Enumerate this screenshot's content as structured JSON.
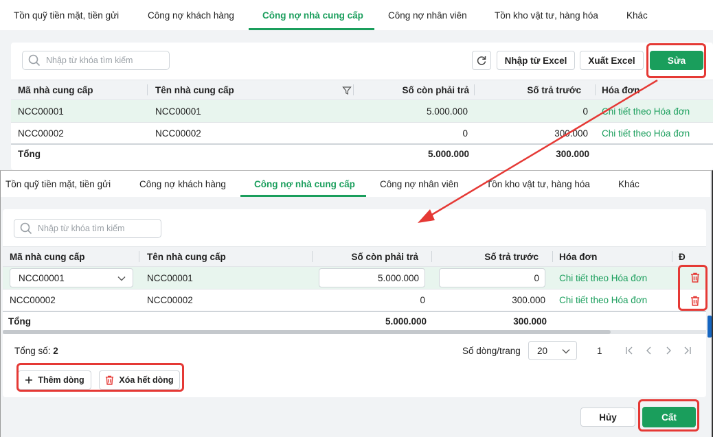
{
  "tabs": [
    "Tồn quỹ tiền mặt, tiền gửi",
    "Công nợ khách hàng",
    "Công nợ nhà cung cấp",
    "Công nợ nhân viên",
    "Tồn kho vật tư, hàng hóa",
    "Khác"
  ],
  "search_placeholder": "Nhập từ khóa tìm kiếm",
  "toolbar": {
    "import_label": "Nhập từ Excel",
    "export_label": "Xuất Excel",
    "edit_label": "Sửa"
  },
  "columns": {
    "code": "Mã nhà cung cấp",
    "name": "Tên nhà cung cấp",
    "payable": "Số còn phải trả",
    "prepaid": "Số trả trước",
    "invoice": "Hóa đơn",
    "delete_short": "Đ"
  },
  "rows": [
    {
      "code": "NCC00001",
      "name": "NCC00001",
      "payable": "5.000.000",
      "prepaid": "0",
      "invoice": "Chi tiết theo Hóa đơn"
    },
    {
      "code": "NCC00002",
      "name": "NCC00002",
      "payable": "0",
      "prepaid": "300.000",
      "invoice": "Chi tiết theo Hóa đơn"
    }
  ],
  "total": {
    "label": "Tổng",
    "payable": "5.000.000",
    "prepaid": "300.000"
  },
  "footer": {
    "total_count_label": "Tổng số:",
    "total_count": "2",
    "rows_per_page_label": "Số dòng/trang",
    "rows_per_page": "20",
    "page": "1"
  },
  "actions": {
    "add_row": "Thêm dòng",
    "delete_all": "Xóa hết dòng",
    "cancel": "Hủy",
    "save": "Cất"
  },
  "colors": {
    "accent": "#1a9e5c",
    "highlight": "#e53935"
  }
}
